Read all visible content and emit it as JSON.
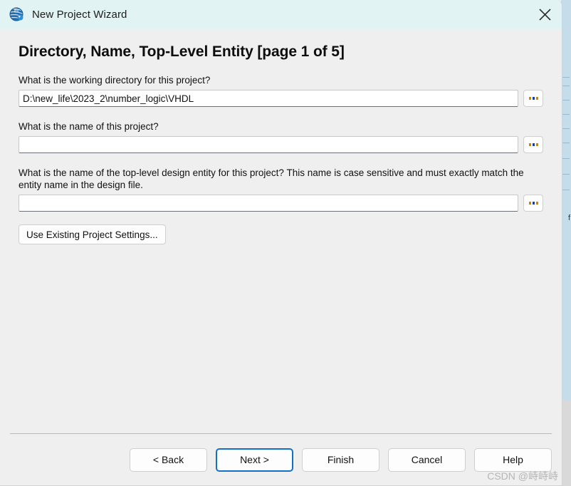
{
  "background": {
    "strip_color": "#c5dcea",
    "glyph": "f"
  },
  "window": {
    "title": "New Project Wizard",
    "icon": "quartus-globe-icon",
    "close_label": "Close",
    "titlebar_color": "#e2f3f3",
    "body_color": "#efefef"
  },
  "page": {
    "heading": "Directory, Name, Top-Level Entity [page 1 of 5]"
  },
  "fields": [
    {
      "label": "What is the working directory for this project?",
      "value": "D:\\new_life\\2023_2\\number_logic\\VHDL",
      "placeholder": "",
      "browse_label": "..."
    },
    {
      "label": "What is the name of this project?",
      "value": "",
      "placeholder": "",
      "browse_label": "..."
    },
    {
      "label": "What is the name of the top-level design entity for this project? This name is case sensitive and must exactly match the entity name in the design file.",
      "value": "",
      "placeholder": "",
      "browse_label": "..."
    }
  ],
  "actions": {
    "use_existing": "Use Existing Project Settings..."
  },
  "footer": {
    "buttons": [
      {
        "label": "< Back",
        "focused": false
      },
      {
        "label": "Next >",
        "focused": true
      },
      {
        "label": "Finish",
        "focused": false
      },
      {
        "label": "Cancel",
        "focused": false
      },
      {
        "label": "Help",
        "focused": false
      }
    ],
    "focus_color": "#1271c4"
  },
  "watermark": {
    "text": "CSDN @峙峙峙"
  }
}
